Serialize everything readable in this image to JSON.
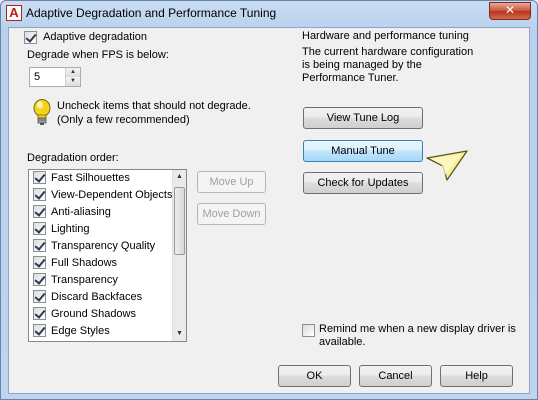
{
  "window": {
    "title": "Adaptive Degradation and Performance Tuning",
    "app_icon_letter": "A",
    "close_glyph": "✕"
  },
  "degradation": {
    "adaptive_label": "Adaptive degradation",
    "adaptive_checked": true,
    "fps_label": "Degrade when FPS is below:",
    "fps_value": "5",
    "info_text_line1": "Uncheck items that should not degrade.",
    "info_text_line2": "(Only a few recommended)",
    "order_label": "Degradation order:",
    "items": [
      {
        "label": "Fast Silhouettes",
        "checked": true
      },
      {
        "label": "View-Dependent Objects",
        "checked": true
      },
      {
        "label": "Anti-aliasing",
        "checked": true
      },
      {
        "label": "Lighting",
        "checked": true
      },
      {
        "label": "Transparency Quality",
        "checked": true
      },
      {
        "label": "Full Shadows",
        "checked": true
      },
      {
        "label": "Transparency",
        "checked": true
      },
      {
        "label": "Discard Backfaces",
        "checked": true
      },
      {
        "label": "Ground Shadows",
        "checked": true
      },
      {
        "label": "Edge Styles",
        "checked": true
      }
    ],
    "move_up_label": "Move Up",
    "move_down_label": "Move Down"
  },
  "hardware": {
    "heading": "Hardware and performance tuning",
    "desc_line1": "The current hardware configuration",
    "desc_line2": "is being managed by the",
    "desc_line3": "Performance Tuner.",
    "view_log_label": "View Tune Log",
    "manual_tune_label": "Manual Tune",
    "check_updates_label": "Check for Updates",
    "remind_line1": "Remind me when a new display driver is",
    "remind_line2": "available.",
    "remind_checked": false
  },
  "footer": {
    "ok_label": "OK",
    "cancel_label": "Cancel",
    "help_label": "Help"
  },
  "icons": {
    "info": "lightbulb-icon",
    "pointer": "pointer-arrow-icon"
  }
}
